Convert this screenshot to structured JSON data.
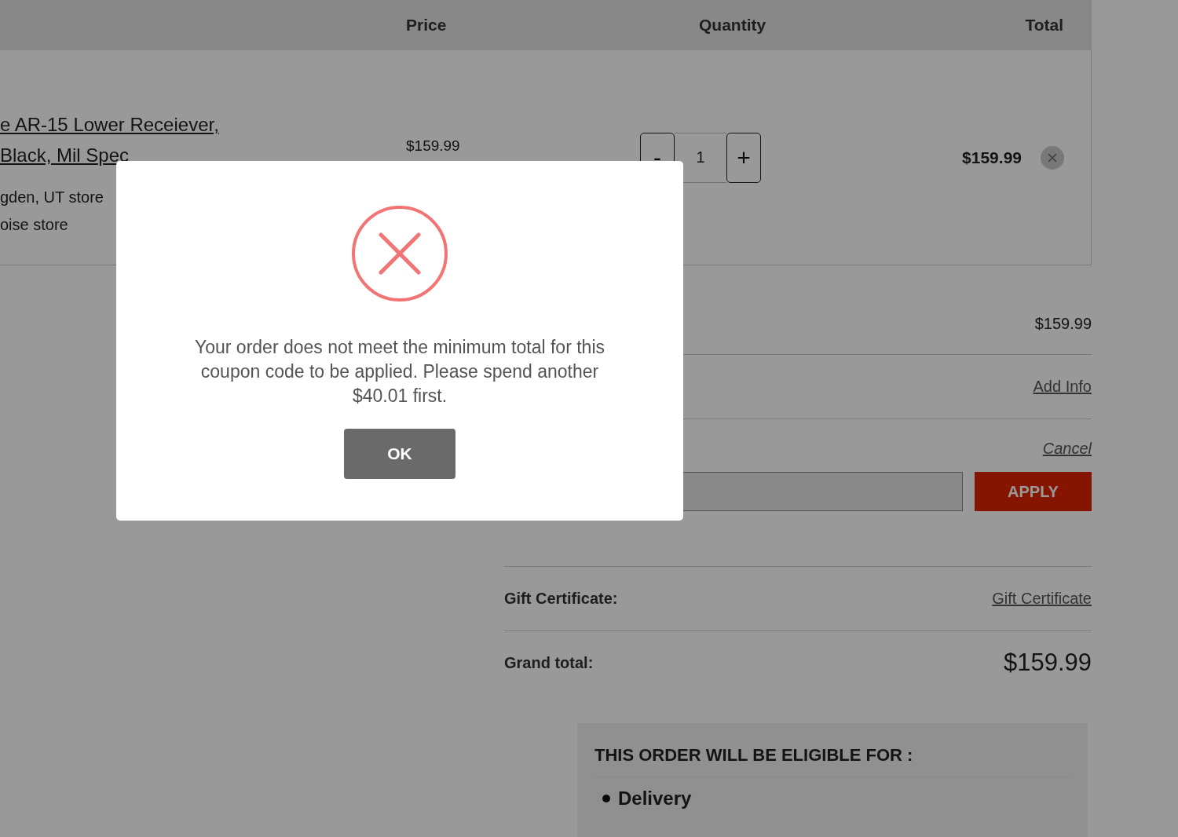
{
  "cart": {
    "columns": [
      "Price",
      "Quantity",
      "Total"
    ],
    "items": [
      {
        "name_lines": [
          "e AR-15 Lower Receiever,",
          "Black, Mil Spec"
        ],
        "stores": [
          "gden, UT store",
          "oise store"
        ],
        "price": "$159.99",
        "decrement": "-",
        "quantity": "1",
        "increment": "+",
        "total": "$159.99"
      }
    ]
  },
  "summary": {
    "subtotal": "$159.99",
    "shipping_link": "Add Info",
    "coupon_cancel": "Cancel",
    "apply_button": "APPLY",
    "gift_label": "Gift Certificate:",
    "gift_link": "Gift Certificate",
    "grand_label": "Grand total:",
    "grand_value": "$159.99"
  },
  "eligibility": {
    "title": "THIS ORDER WILL BE ELIGIBLE FOR :",
    "options": [
      "Delivery"
    ]
  },
  "dialog": {
    "message": "Your order does not meet the minimum total for this coupon code to be applied. Please spend another $40.01 first.",
    "button": "OK"
  }
}
